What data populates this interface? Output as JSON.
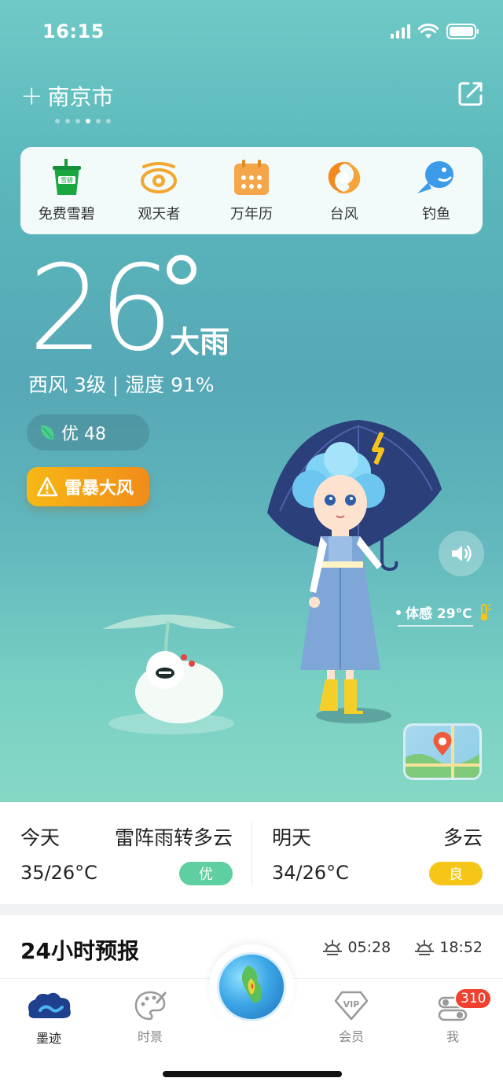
{
  "status_bar": {
    "time": "16:15"
  },
  "header": {
    "city": "南京市",
    "page_count": 6,
    "active_page": 4
  },
  "quick_bar": {
    "items": [
      {
        "label": "免费雪碧",
        "icon": "sprite-cup-icon"
      },
      {
        "label": "观天者",
        "icon": "eye-icon"
      },
      {
        "label": "万年历",
        "icon": "calendar-icon"
      },
      {
        "label": "台风",
        "icon": "typhoon-icon"
      },
      {
        "label": "钓鱼",
        "icon": "fish-icon"
      }
    ]
  },
  "current": {
    "temperature": "26",
    "condition": "大雨",
    "wind_humidity": "西风 3级 | 湿度 91%",
    "aqi_text": "优 48",
    "warning_text": "雷暴大风",
    "feels_like": "体感 29°C"
  },
  "forecast": {
    "today": {
      "day": "今天",
      "condition": "雷阵雨转多云",
      "range": "35/26°C",
      "aqi": "优",
      "aqi_color": "#5dcfa0"
    },
    "tomorrow": {
      "day": "明天",
      "condition": "多云",
      "range": "34/26°C",
      "aqi": "良",
      "aqi_color": "#f5c518"
    }
  },
  "hourly": {
    "title": "24小时预报",
    "sunrise": "05:28",
    "sunset": "18:52"
  },
  "tab_bar": {
    "items": [
      {
        "label": "墨迹",
        "active": true
      },
      {
        "label": "时景",
        "active": false
      },
      {
        "label": "会员",
        "active": false
      },
      {
        "label": "我",
        "active": false
      }
    ],
    "badge": "310"
  },
  "colors": {
    "accent": "#f7b814",
    "hero_top": "#6fcac6",
    "hero_bottom": "#86d8c5"
  }
}
